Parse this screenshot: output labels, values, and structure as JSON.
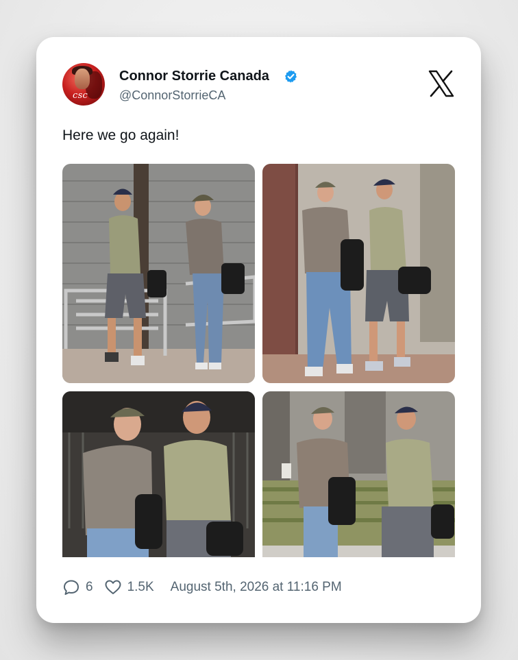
{
  "tweet": {
    "display_name": "Connor Storrie Canada",
    "handle": "@ConnorStorrieCA",
    "verified": true,
    "avatar_text": "csc",
    "text": "Here we go again!",
    "replies": "6",
    "likes": "1.5K",
    "timestamp": "August 5th, 2026 at 11:16 PM",
    "platform_icon": "x-logo-icon",
    "accent_color": "#1d9bf0"
  },
  "photos": [
    {
      "name": "photo-1",
      "alt_icon": "two-men-walking-street-railings"
    },
    {
      "name": "photo-2",
      "alt_icon": "two-men-walking-granite-wall"
    },
    {
      "name": "photo-3",
      "alt_icon": "two-men-closeup-walking"
    },
    {
      "name": "photo-4",
      "alt_icon": "two-men-walking-plants"
    }
  ]
}
